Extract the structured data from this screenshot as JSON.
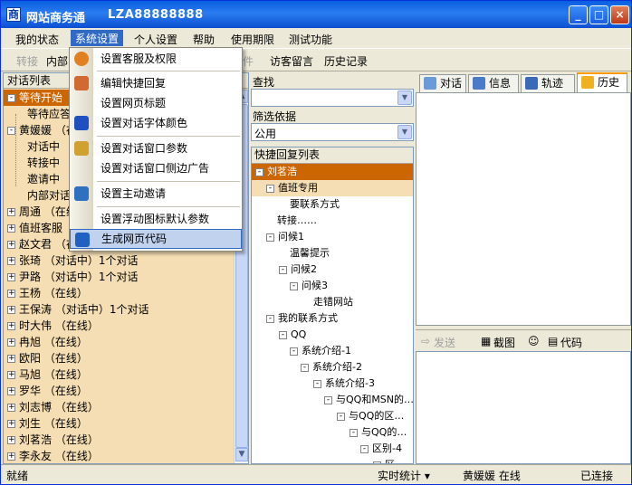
{
  "window": {
    "title": "网站商务通",
    "account": "LZA88888888",
    "min": "_",
    "max": "□",
    "close": "×"
  },
  "menu": {
    "my_status": "我的状态",
    "system_settings": "系统设置",
    "personal_settings": "个人设置",
    "help": "帮助",
    "usage_period": "使用期限",
    "test_features": "测试功能"
  },
  "toolbar": {
    "transfer": "转接",
    "internal": "内部",
    "file": "件",
    "visitor_message": "访客留言",
    "history_record": "历史记录"
  },
  "dropdown": {
    "items": [
      "设置客服及权限",
      "编辑快捷回复",
      "设置网页标题",
      "设置对话字体颜色",
      "设置对话窗口参数",
      "设置对话窗口侧边广告",
      "设置主动邀请",
      "设置浮动图标默认参数",
      "生成网页代码"
    ]
  },
  "left": {
    "header": "对话列表",
    "rows": [
      {
        "label": "等待开始",
        "sign": "-"
      },
      {
        "label": "等待应答",
        "sign": ""
      },
      {
        "label": "黄媛媛 （在",
        "sign": "-"
      },
      {
        "label": "对话中",
        "sign": ""
      },
      {
        "label": "转接中",
        "sign": ""
      },
      {
        "label": "邀请中",
        "sign": ""
      },
      {
        "label": "内部对话",
        "sign": ""
      },
      {
        "label": "周通 （在线",
        "sign": "+"
      },
      {
        "label": "值班客服",
        "sign": "+"
      },
      {
        "label": "赵文君 （在",
        "sign": "+"
      },
      {
        "label": "张琦 （对话中）1个对话",
        "sign": "+"
      },
      {
        "label": "尹路 （对话中）1个对话",
        "sign": "+"
      },
      {
        "label": "王杨 （在线）",
        "sign": "+"
      },
      {
        "label": "王保涛 （对话中）1个对话",
        "sign": "+"
      },
      {
        "label": "时大伟 （在线）",
        "sign": "+"
      },
      {
        "label": "冉旭 （在线）",
        "sign": "+"
      },
      {
        "label": "欧阳 （在线）",
        "sign": "+"
      },
      {
        "label": "马旭 （在线）",
        "sign": "+"
      },
      {
        "label": "罗华 （在线）",
        "sign": "+"
      },
      {
        "label": "刘志博 （在线）",
        "sign": "+"
      },
      {
        "label": "刘生 （在线）",
        "sign": "+"
      },
      {
        "label": "刘茗浩 （在线）",
        "sign": "+"
      },
      {
        "label": "李永友 （在线）",
        "sign": "+"
      }
    ]
  },
  "mid": {
    "search_label": "查找",
    "search_value": "",
    "filter_label": "筛选依据",
    "filter_value": "公用",
    "quick_header": "快捷回复列表",
    "tree": [
      "刘茗浩",
      "值班专用",
      "要联系方式",
      "转接……",
      "问候1",
      "温馨提示",
      "问候2",
      "问候3",
      "走错网站",
      "我的联系方式",
      "QQ",
      "系统介绍-1",
      "系统介绍-2",
      "系统介绍-3",
      "与QQ和MSN的…",
      "与QQ的区…",
      "与QQ的…",
      "区别-4",
      "区…"
    ]
  },
  "right": {
    "tabs": [
      "对话",
      "信息",
      "轨迹",
      "历史"
    ],
    "send": "发送",
    "screenshot": "截图",
    "code": "代码"
  },
  "status": {
    "ready": "就绪",
    "realtime": "实时统计 ▾",
    "user": "黄媛媛 在线",
    "connected": "已连接"
  }
}
